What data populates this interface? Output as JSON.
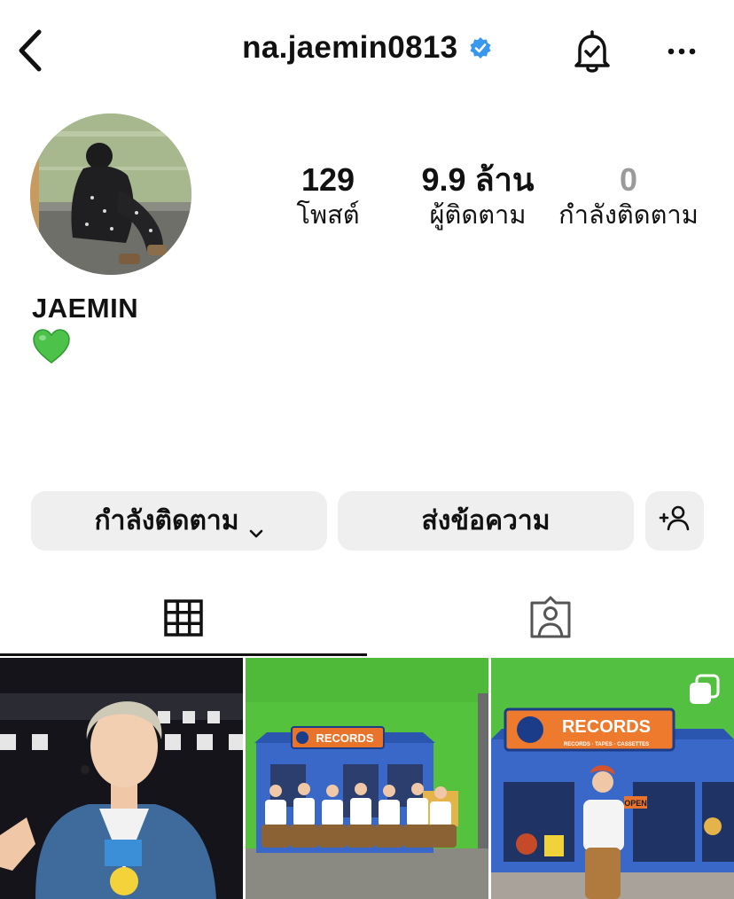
{
  "header": {
    "handle": "na.jaemin0813",
    "verified_icon": "verified-badge-icon",
    "back_icon": "chevron-left-icon",
    "bell_icon": "notification-bell-icon",
    "more_icon": "more-options-icon"
  },
  "profile": {
    "name": "JAEMIN",
    "bio_emoji": "💚",
    "avatar": "profile-photo"
  },
  "stats": [
    {
      "count": "129",
      "label": "โพสต์"
    },
    {
      "count": "9.9 ล้าน",
      "label": "ผู้ติดตาม"
    },
    {
      "count": "0",
      "label": "กำลังติดตาม"
    }
  ],
  "actions": {
    "following_label": "กำลังติดตาม",
    "message_label": "ส่งข้อความ",
    "add_user_icon": "add-user-icon"
  },
  "tabs": {
    "grid_icon": "grid-icon",
    "tagged_icon": "tagged-icon",
    "active": "grid"
  },
  "posts": [
    {
      "image": "performer-denim-jacket-photo"
    },
    {
      "image": "group-photo-records-store-set",
      "sign_text": "RECORDS"
    },
    {
      "image": "single-person-records-store-set",
      "sign_text": "RECORDS",
      "sign_subtext": "RECORDS · TAPES · CASSETTES",
      "door_sign": "OPEN",
      "multi_icon": "multiple-photos-icon"
    }
  ],
  "colors": {
    "accent_blue": "#3897f0",
    "button_bg": "#efefef",
    "heart_green": "#4cc24a"
  }
}
